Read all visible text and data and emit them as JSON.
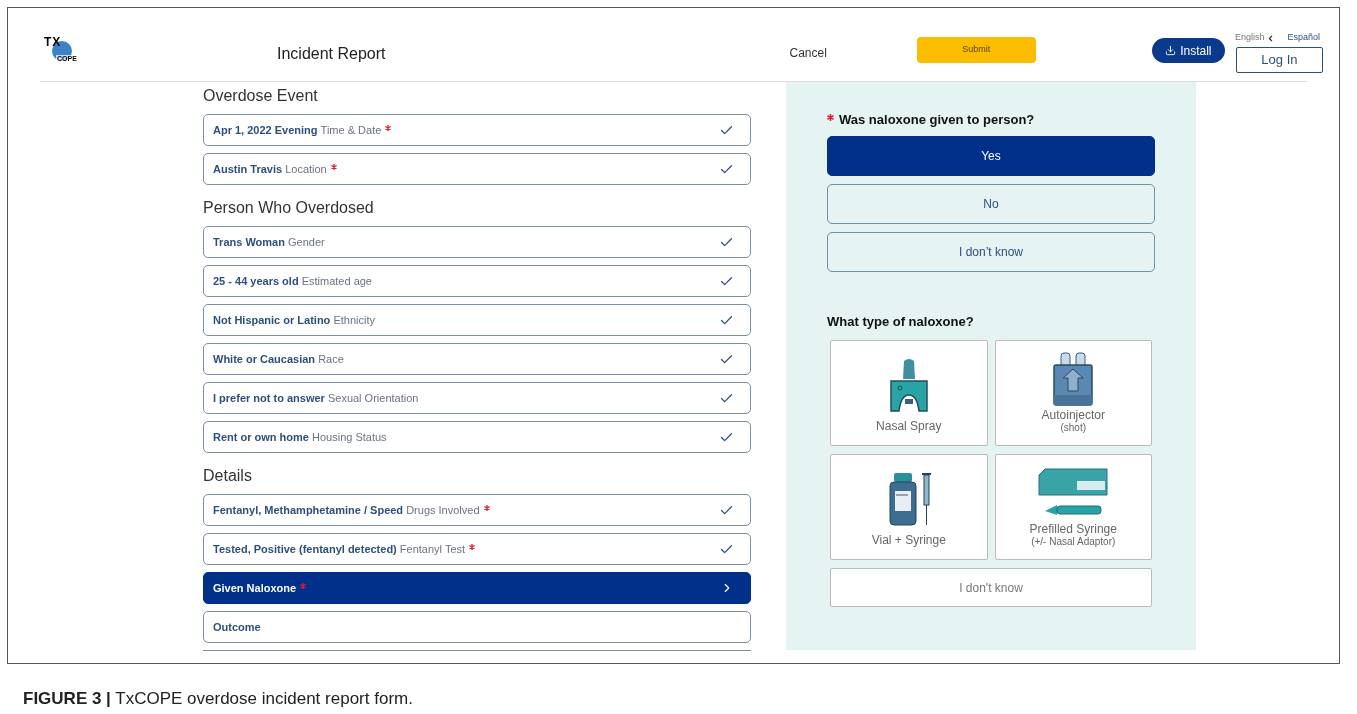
{
  "header": {
    "logo": {
      "top": "TX",
      "bottom": "COPE"
    },
    "title": "Incident Report",
    "cancel": "Cancel",
    "submit": "Submit",
    "install": "Install",
    "languages": [
      {
        "label": "English",
        "selected": true
      },
      {
        "label": "Español",
        "selected": false
      }
    ],
    "login": "Log In"
  },
  "sections": [
    {
      "title": "Overdose Event",
      "items": [
        {
          "value": "Apr 1, 2022 Evening",
          "label": "Time & Date",
          "required": true,
          "completed": true,
          "selected": false
        },
        {
          "value": "Austin Travis",
          "label": "Location",
          "required": true,
          "completed": true,
          "selected": false
        }
      ]
    },
    {
      "title": "Person Who Overdosed",
      "items": [
        {
          "value": "Trans Woman",
          "label": "Gender",
          "required": false,
          "completed": true,
          "selected": false
        },
        {
          "value": "25 - 44 years old",
          "label": "Estimated age",
          "required": false,
          "completed": true,
          "selected": false
        },
        {
          "value": "Not Hispanic or Latino",
          "label": "Ethnicity",
          "required": false,
          "completed": true,
          "selected": false
        },
        {
          "value": "White or Caucasian",
          "label": "Race",
          "required": false,
          "completed": true,
          "selected": false
        },
        {
          "value": "I prefer not to answer",
          "label": "Sexual Orientation",
          "required": false,
          "completed": true,
          "selected": false
        },
        {
          "value": "Rent or own home",
          "label": "Housing Status",
          "required": false,
          "completed": true,
          "selected": false
        }
      ]
    },
    {
      "title": "Details",
      "items": [
        {
          "value": "Fentanyl, Methamphetamine / Speed",
          "label": "Drugs Involved",
          "required": true,
          "completed": true,
          "selected": false
        },
        {
          "value": "Tested, Positive (fentanyl detected)",
          "label": "Fentanyl Test",
          "required": true,
          "completed": true,
          "selected": false
        },
        {
          "label": "Given Naloxone",
          "required": true,
          "completed": false,
          "selected": true
        },
        {
          "label": "Outcome",
          "required": false,
          "completed": false,
          "selected": false
        }
      ]
    }
  ],
  "question": {
    "text": "Was naloxone given to person?",
    "required": true,
    "options": [
      {
        "label": "Yes",
        "selected": true
      },
      {
        "label": "No",
        "selected": false
      },
      {
        "label": "I don’t know",
        "selected": false
      }
    ]
  },
  "naloxone_type": {
    "text": "What type of naloxone?",
    "options": [
      {
        "kind": "nasal_spray",
        "label": "Nasal Spray",
        "selected": false
      },
      {
        "kind": "autoinjector",
        "label": "Autoinjector",
        "note": "(shot)",
        "selected": false
      },
      {
        "kind": "vial_syringe",
        "label": "Vial + Syringe",
        "selected": false
      },
      {
        "kind": "prefilled_syringe",
        "label": "Prefilled Syringe",
        "note": "(+/- Nasal Adaptor)",
        "selected": false
      },
      {
        "kind": "text",
        "label": "I don't know",
        "selected": false
      }
    ]
  },
  "caption": "**FIGURE 3 |** TxCOPE overdose incident report form."
}
